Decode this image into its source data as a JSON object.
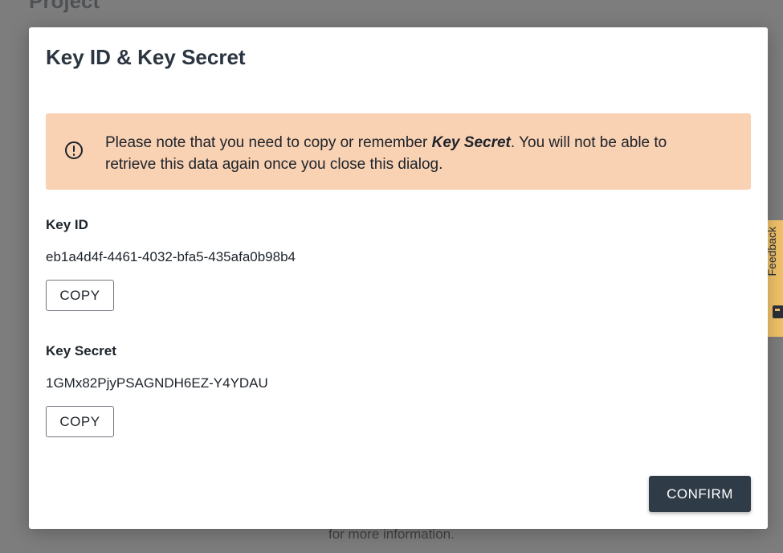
{
  "background": {
    "page_title": "Project",
    "footer_text": "for more information."
  },
  "feedback_tab": {
    "label": "Feedback"
  },
  "dialog": {
    "title": "Key ID & Key Secret",
    "warning": {
      "text_before": "Please note that you need to copy or remember ",
      "emphasis": "Key Secret",
      "text_after": ". You will not be able to retrieve this data again once you close this dialog."
    },
    "key_id": {
      "label": "Key ID",
      "value": "eb1a4d4f-4461-4032-bfa5-435afa0b98b4",
      "copy_label": "COPY"
    },
    "key_secret": {
      "label": "Key Secret",
      "value": "1GMx82PjyPSAGNDH6EZ-Y4YDAU",
      "copy_label": "COPY"
    },
    "confirm_label": "CONFIRM"
  },
  "colors": {
    "overlay": "#7d7d7d",
    "warning_background": "#f9d1b3",
    "confirm_background": "#2f3c48",
    "feedback_background": "#f1c36a"
  },
  "icons": {
    "warning": "exclamation-circle-icon",
    "feedback": "chat-icon"
  }
}
